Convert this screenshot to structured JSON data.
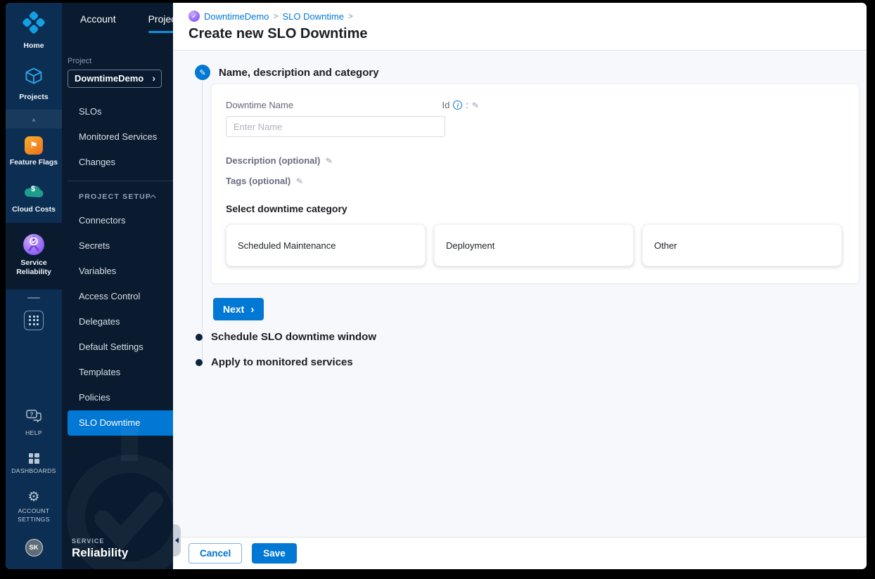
{
  "colors": {
    "accent_blue": "#0278d5",
    "module_nav_bg": "#0c2e52",
    "sidebar_bg": "#0a1b2f",
    "page_bg": "#f7f8fb",
    "active_item_bg": "#0278d5",
    "feature_flags_orange": "#ec6e1f",
    "cloud_costs_teal": "#1d9d8b",
    "service_reliability_purple": "#8b5cf6",
    "home_logo_blue": "#14a0e4"
  },
  "icons": {
    "flag": "⚑",
    "dollar": "$",
    "scroll_up": "▲",
    "gear": "⚙",
    "question": "?",
    "pencil": "✎",
    "info_i": "i",
    "check": "✓",
    "chevron_right": "›",
    "colon": ":"
  },
  "module_nav": {
    "home": "Home",
    "projects": "Projects",
    "feature_flags": "Feature Flags",
    "cloud_costs": "Cloud Costs",
    "service_reliability": "Service Reliability",
    "help": "HELP",
    "dashboards": "DASHBOARDS",
    "account_settings_line1": "ACCOUNT",
    "account_settings_line2": "SETTINGS",
    "avatar_initials": "SK"
  },
  "sidebar": {
    "tab_account": "Account",
    "tab_project": "Project",
    "project_label": "Project",
    "project_name": "DowntimeDemo",
    "nav": [
      "SLOs",
      "Monitored Services",
      "Changes"
    ],
    "section_label": "PROJECT SETUP",
    "setup_nav": [
      "Connectors",
      "Secrets",
      "Variables",
      "Access Control",
      "Delegates",
      "Default Settings",
      "Templates",
      "Policies",
      "SLO Downtime"
    ],
    "active_item": "SLO Downtime",
    "footer_kicker": "SERVICE",
    "footer_title": "Reliability"
  },
  "header": {
    "breadcrumb_project": "DowntimeDemo",
    "breadcrumb_page": "SLO Downtime",
    "separator": ">",
    "title": "Create new SLO Downtime"
  },
  "wizard": {
    "step1_title": "Name, description and category",
    "step2_title": "Schedule SLO downtime window",
    "step3_title": "Apply to monitored services",
    "name_label": "Downtime Name",
    "id_label": "Id",
    "name_placeholder": "Enter Name",
    "description_label": "Description (optional)",
    "tags_label": "Tags (optional)",
    "category_label": "Select downtime category",
    "categories": [
      "Scheduled Maintenance",
      "Deployment",
      "Other"
    ],
    "next_label": "Next"
  },
  "footer": {
    "cancel_label": "Cancel",
    "save_label": "Save"
  }
}
